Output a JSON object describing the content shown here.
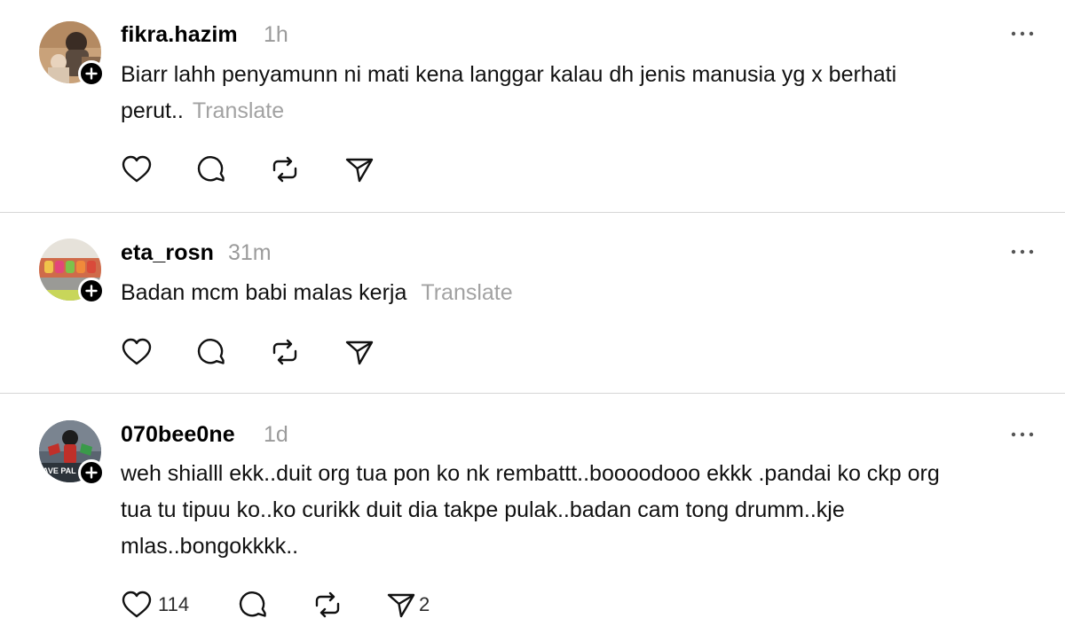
{
  "posts": [
    {
      "username": "fikra.hazim",
      "time": "1h",
      "text": "Biarr lahh penyamunn ni mati kena langgar kalau dh jenis manusia yg x berhati perut..",
      "translate_label": "Translate",
      "like_count": "",
      "share_count": ""
    },
    {
      "username": "eta_rosn",
      "time": "31m",
      "text": "Badan mcm babi malas kerja",
      "translate_label": "Translate",
      "like_count": "",
      "share_count": ""
    },
    {
      "username": "070bee0ne",
      "time": "1d",
      "text": "weh shialll ekk..duit org tua pon ko nk rembattt..boooodooo ekkk .pandai ko ckp org tua tu tipuu ko..ko curikk duit dia takpe pulak..badan cam tong drumm..kje mlas..bongokkkk..",
      "translate_label": "",
      "like_count": "114",
      "share_count": "2"
    }
  ],
  "icons": {
    "like": "heart-icon",
    "reply": "comment-icon",
    "repost": "repost-icon",
    "share": "send-icon",
    "more": "more-icon",
    "follow": "plus-icon"
  },
  "colors": {
    "text": "#111111",
    "muted": "#9b9b9b",
    "divider": "#d6d6d6"
  }
}
